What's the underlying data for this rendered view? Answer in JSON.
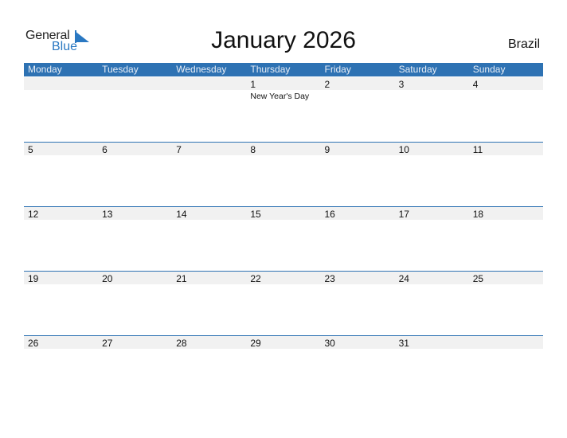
{
  "logo": {
    "line1": "General",
    "line2": "Blue",
    "accent_color": "#2a78c2"
  },
  "title": "January 2026",
  "country": "Brazil",
  "header_color": "#2e72b3",
  "weekdays": [
    "Monday",
    "Tuesday",
    "Wednesday",
    "Thursday",
    "Friday",
    "Saturday",
    "Sunday"
  ],
  "weeks": [
    {
      "days": [
        "",
        "",
        "",
        "1",
        "2",
        "3",
        "4"
      ],
      "holidays": [
        "",
        "",
        "",
        "New Year's Day",
        "",
        "",
        ""
      ]
    },
    {
      "days": [
        "5",
        "6",
        "7",
        "8",
        "9",
        "10",
        "11"
      ],
      "holidays": [
        "",
        "",
        "",
        "",
        "",
        "",
        ""
      ]
    },
    {
      "days": [
        "12",
        "13",
        "14",
        "15",
        "16",
        "17",
        "18"
      ],
      "holidays": [
        "",
        "",
        "",
        "",
        "",
        "",
        ""
      ]
    },
    {
      "days": [
        "19",
        "20",
        "21",
        "22",
        "23",
        "24",
        "25"
      ],
      "holidays": [
        "",
        "",
        "",
        "",
        "",
        "",
        ""
      ]
    },
    {
      "days": [
        "26",
        "27",
        "28",
        "29",
        "30",
        "31",
        ""
      ],
      "holidays": [
        "",
        "",
        "",
        "",
        "",
        "",
        ""
      ]
    }
  ]
}
